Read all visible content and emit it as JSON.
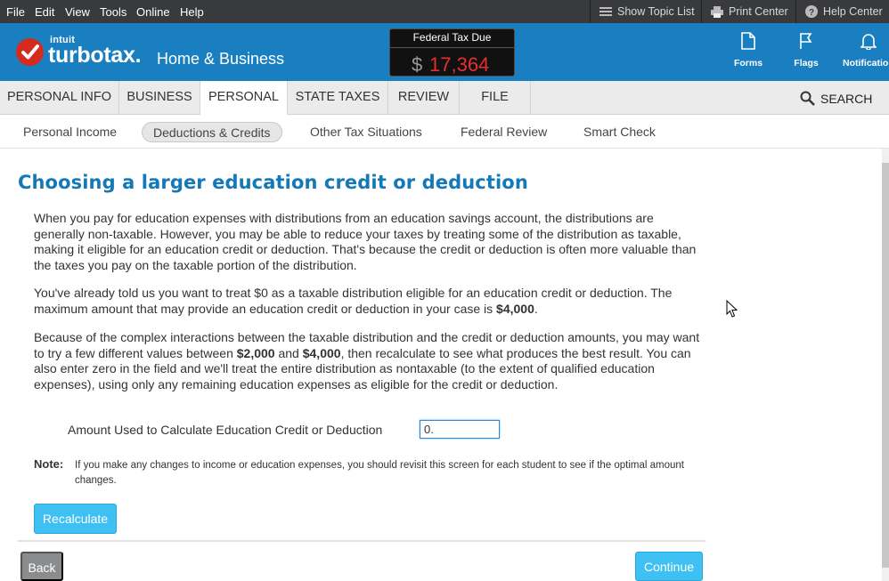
{
  "menubar": {
    "items": [
      "File",
      "Edit",
      "View",
      "Tools",
      "Online",
      "Help"
    ],
    "show_topic_list": "Show Topic List",
    "print_center": "Print Center",
    "help_center": "Help Center"
  },
  "header": {
    "logo_small": "intuit",
    "logo_main": "turbotax.",
    "edition": "Home & Business",
    "tax_due_label": "Federal Tax Due",
    "tax_due_currency": "$",
    "tax_due_amount": "17,364",
    "icons": {
      "forms": "Forms",
      "flags": "Flags",
      "notifications": "Notifications"
    }
  },
  "tabs": [
    "PERSONAL INFO",
    "BUSINESS",
    "PERSONAL",
    "STATE TAXES",
    "REVIEW",
    "FILE"
  ],
  "active_tab": "PERSONAL",
  "search_label": "SEARCH",
  "subtabs": [
    "Personal Income",
    "Deductions & Credits",
    "Other Tax Situations",
    "Federal Review",
    "Smart Check"
  ],
  "active_subtab": "Deductions & Credits",
  "content": {
    "title": "Choosing a larger education credit or deduction",
    "p1": "When you pay for education expenses with distributions from an education savings account, the distributions are generally non-taxable. However, you may be able to reduce your taxes by treating some of the distribution as taxable, making it eligible for an education credit or deduction. That's because the credit or deduction is often more valuable than the taxes you pay on the taxable portion of the distribution.",
    "p2_a": "You've already told us you want to treat $0 as a taxable distribution eligible for an education credit or deduction. The maximum amount that may provide an education credit or deduction in your case is ",
    "p2_max": "$4,000",
    "p2_end": ".",
    "p3_a": "Because of the complex interactions between the taxable distribution and the credit or deduction amounts, you may want to try a few different values between ",
    "p3_min": "$2,000",
    "p3_and": " and ",
    "p3_max": "$4,000",
    "p3_b": ", then recalculate to see what produces the best result. You can also enter zero in the field and we'll treat the entire distribution as nontaxable (to the extent of qualified education expenses), using only any remaining education expenses as eligible for the credit or deduction.",
    "amount_label": "Amount Used to Calculate Education Credit or Deduction",
    "amount_value": "0.",
    "note_label": "Note:",
    "note_text": "If you make any changes to income or education expenses, you should revisit this screen for each student to see if the optimal amount changes.",
    "recalculate": "Recalculate",
    "back": "Back",
    "continue": "Continue"
  }
}
